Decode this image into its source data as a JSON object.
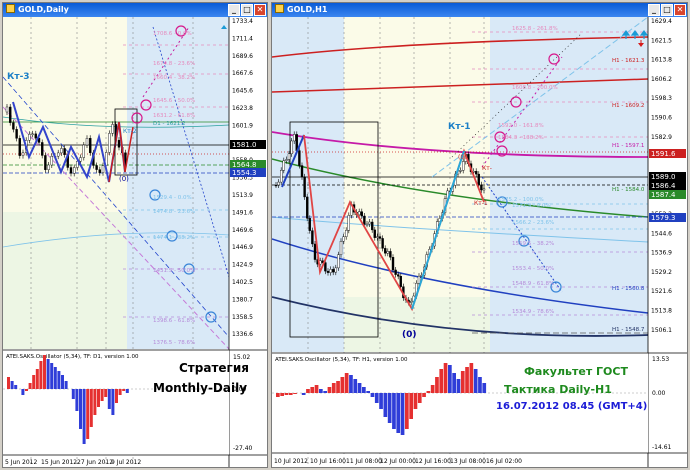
{
  "left_window": {
    "title": "GOLD,Daily",
    "price_ticks": [
      "1733.4",
      "1711.4",
      "1689.6",
      "1667.6",
      "1645.6",
      "1623.8",
      "1601.9",
      "1580.0",
      "1558.0",
      "1536.3",
      "1513.9",
      "1491.6",
      "1469.6",
      "1446.9",
      "1424.9",
      "1402.5",
      "1380.7",
      "1358.5",
      "1336.6"
    ],
    "price_labels": [
      "1581.0",
      "1564.8",
      "1554.3"
    ],
    "fib_labels": [
      "1708.6 - 0.0%",
      "1674.8 - 23.6%",
      "1660.4 - 38.2%",
      "1645.6 - 50.0%",
      "1631.2 - 61.8%",
      "D1 - 1621.2",
      "1529.4 - 0.0%",
      "1474.8 - 23.6%",
      "1474.1 - 38.2%",
      "1431.5 - 50.0%",
      "1398.6 - 61.8%",
      "1376.5 - 78.6%"
    ],
    "wave_labels": [
      "Кт-3",
      "Кт-2",
      "(0)"
    ],
    "osc_label": "ATEI.SAKS.Oscillator (5,34), TF: D1, version 1.00",
    "osc_ticks": [
      "15.02",
      "0.00",
      "-27.40"
    ],
    "dates": [
      "5 Jun 2012",
      "15 Jun 2012",
      "27 Jun 2012",
      "9 Jul 2012"
    ],
    "strategy_title": "Стратегия",
    "strategy_sub": "Monthly-Daily"
  },
  "right_window": {
    "title": "GOLD,H1",
    "price_ticks": [
      "1629.4",
      "1621.5",
      "1613.8",
      "1606.2",
      "1598.3",
      "1590.6",
      "1582.9",
      "1575.2",
      "1567.6",
      "1559.9",
      "1552.2",
      "1544.6",
      "1536.9",
      "1529.2",
      "1521.6",
      "1513.8",
      "1506.1"
    ],
    "price_labels": [
      "1591.6",
      "1589.0",
      "1586.4",
      "1587.4",
      "1579.3"
    ],
    "fib_labels": [
      "1625.8 - 261.8%",
      "H1 - 1621.3",
      "1608.8 - 200.0%",
      "H1 - 1609.2",
      "1592.0 - 161.8%",
      "H1 - 1597.1",
      "1584.3 - 138.2%",
      "1575.2 - 100.0%",
      "H1 - 1584.0",
      "1571.9 - 0.0%",
      "1566.2 - 23.6%",
      "1559.5 - 38.2%",
      "1553.4 - 50.0%",
      "1548.9 - 61.8%",
      "H1 - 1560.8",
      "1534.9 - 78.6%",
      "H1 - 1548.7"
    ],
    "wave_labels": [
      "Кт-1",
      "(0)",
      "(0)",
      "Кт-",
      "Кт-1"
    ],
    "osc_label": "ATEI.SAKS.Oscillator (5,34), TF: H1, version 1.00",
    "osc_ticks": [
      "13.53",
      "0.00",
      "-14.61"
    ],
    "dates": [
      "10 Jul 2012",
      "10 Jul 16:00",
      "11 Jul 08:00",
      "12 Jul 00:00",
      "12 Jul 16:00",
      "13 Jul 08:00",
      "16 Jul 02:00"
    ],
    "faculty_title": "Факультет ГОСТ",
    "tactic": "Тактика Daily-H1",
    "datetime": "16.07.2012  08.45 (GMT+4)"
  },
  "colors": {
    "title_bar": "#0a5bd6",
    "green_text": "#1e8a1e",
    "blue_text": "#1b1bd6",
    "osc_up": "#e53030",
    "osc_down": "#2f3dd8"
  }
}
